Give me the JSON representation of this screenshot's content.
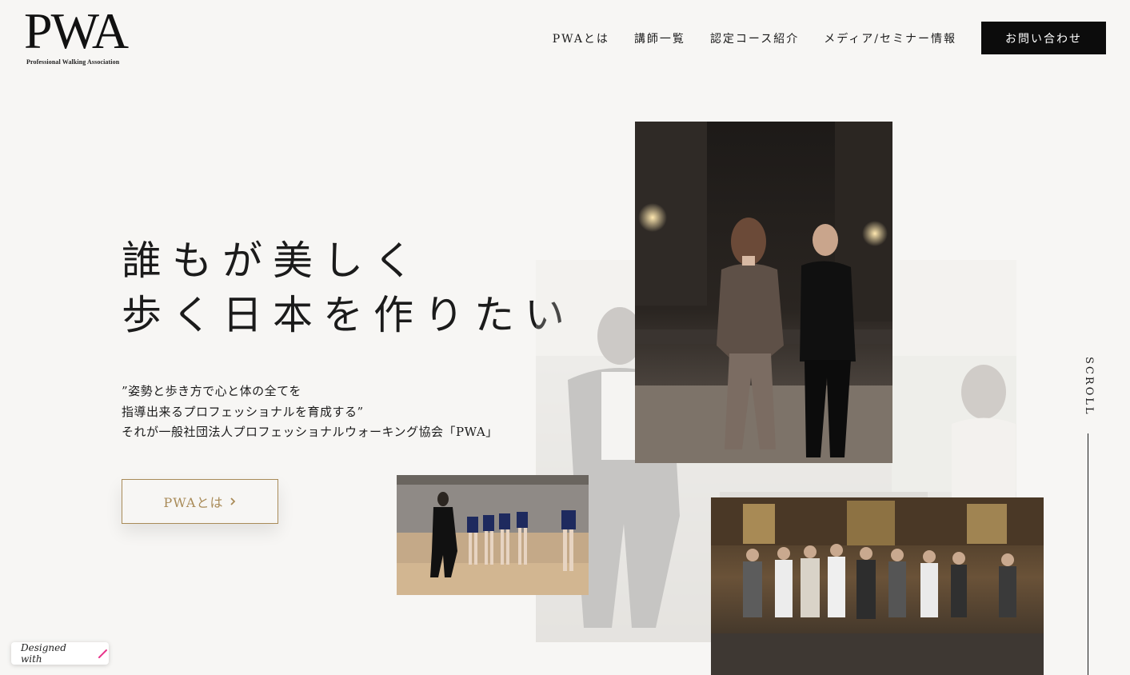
{
  "brand": {
    "logo_text": "PWA",
    "logo_subtext": "Professional Walking Association"
  },
  "nav": {
    "items": [
      "PWAとは",
      "講師一覧",
      "認定コース紹介",
      "メディア/セミナー情報"
    ],
    "contact_label": "お問い合わせ"
  },
  "hero": {
    "headline_lines": [
      "誰もが美しく",
      "歩く日本を作りたい"
    ],
    "lead_lines": [
      "”姿勢と歩き方で心と体の全てを",
      "指導出来るプロフェッショナルを育成する”",
      "それが一般社団法人プロフェッショナルウォーキング協会「PWA」"
    ],
    "cta_label": "PWAとは"
  },
  "scroll_label": "SCROLL",
  "badge": {
    "label": "Designed with"
  },
  "colors": {
    "background": "#f7f6f4",
    "accent_gold": "#a98b58",
    "button_dark": "#0c0c0c",
    "badge_pen": "#e8338a"
  },
  "icons": {
    "cta_arrow": "chevron-right-icon",
    "badge_pen": "pen-icon"
  }
}
